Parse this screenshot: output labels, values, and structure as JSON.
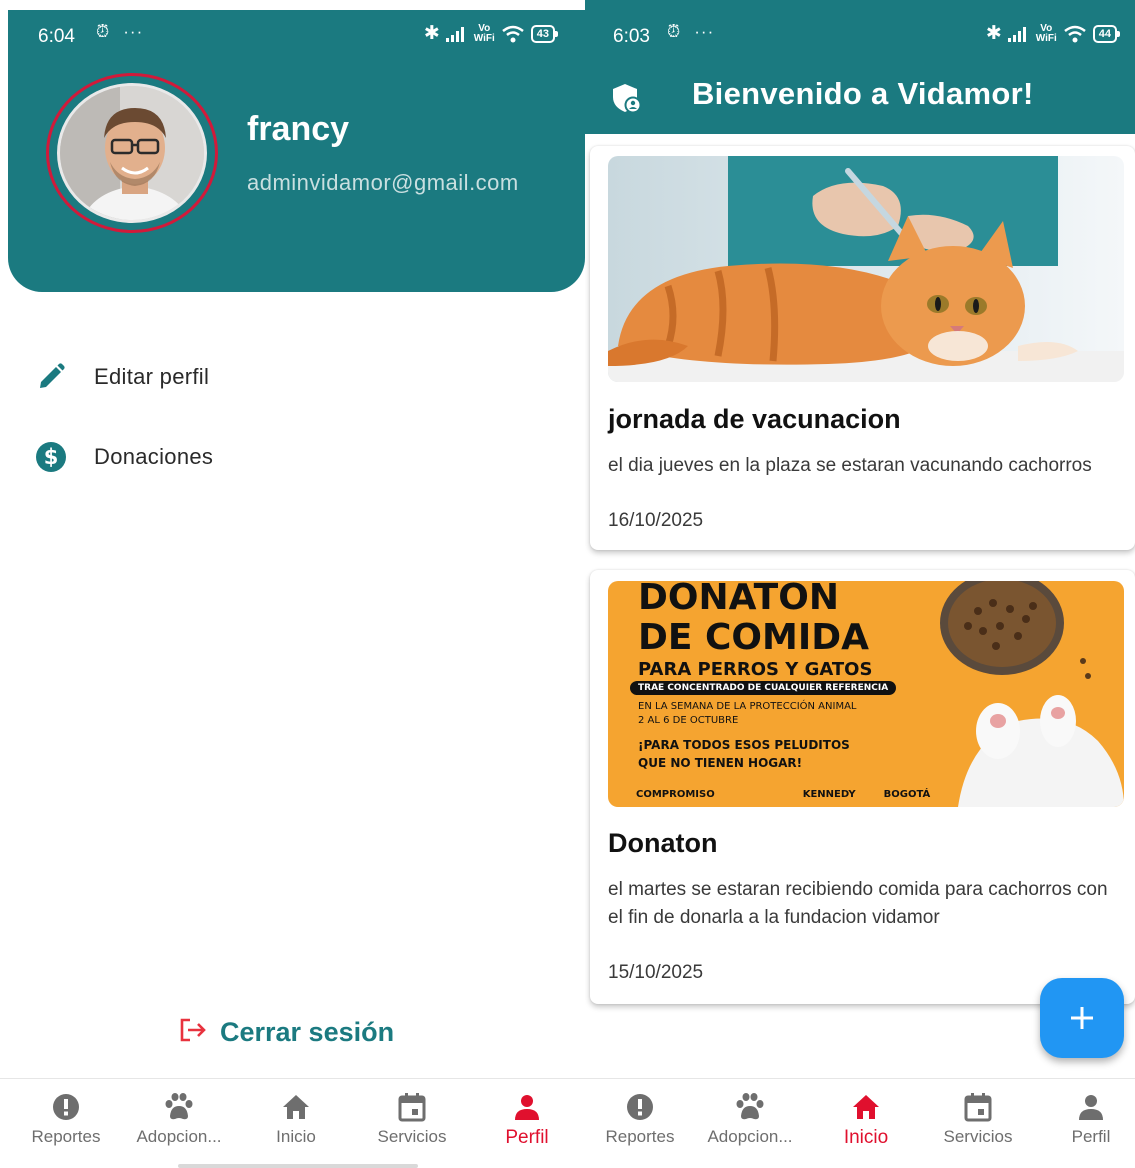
{
  "colors": {
    "teal": "#1b7a80",
    "accent_red": "#e0102e",
    "fab_blue": "#2196f3",
    "poster_orange": "#f5a430"
  },
  "profile_screen": {
    "status_bar": {
      "time": "6:04",
      "battery": "43",
      "wifi_label": "Vo WiFi"
    },
    "user": {
      "name": "francy",
      "email": "adminvidamor@gmail.com"
    },
    "menu": [
      {
        "label": "Editar perfil",
        "icon": "pencil-icon"
      },
      {
        "label": "Donaciones",
        "icon": "dollar-icon"
      }
    ],
    "logout_label": "Cerrar sesión",
    "nav": [
      {
        "label": "Reportes",
        "icon": "alert-icon",
        "active": false
      },
      {
        "label": "Adopcion...",
        "icon": "paw-icon",
        "active": false
      },
      {
        "label": "Inicio",
        "icon": "home-icon",
        "active": false
      },
      {
        "label": "Servicios",
        "icon": "calendar-icon",
        "active": false
      },
      {
        "label": "Perfil",
        "icon": "person-icon",
        "active": true
      }
    ]
  },
  "home_screen": {
    "status_bar": {
      "time": "6:03",
      "battery": "44",
      "wifi_label": "Vo WiFi"
    },
    "appbar_title": "Bienvenido a Vidamor!",
    "posts": [
      {
        "title": "jornada de vacunacion",
        "description": "el dia jueves en la plaza se estaran vacunando cachorros",
        "date": "16/10/2025",
        "image": "cat-vaccination-photo"
      },
      {
        "title": "Donaton",
        "description": "el martes se estaran recibiendo comida para cachorros con el fin de donarla a la fundacion vidamor",
        "date": "15/10/2025",
        "image": "donation-poster"
      }
    ],
    "poster": {
      "line1": "DONATON",
      "line2": "DE COMIDA",
      "line3": "PARA PERROS Y GATOS",
      "tag": "TRAE CONCENTRADO DE CUALQUIER REFERENCIA",
      "line4": "EN LA SEMANA DE LA PROTECCIÓN ANIMAL",
      "line5": "2 AL 6 DE OCTUBRE",
      "line6": "¡PARA TODOS ESOS PELUDITOS",
      "line7": "QUE NO TIENEN HOGAR!",
      "footer1": "COMPROMISO",
      "footer2": "KENNEDY",
      "footer3": "BOGOTÁ"
    },
    "fab_symbol": "+",
    "nav": [
      {
        "label": "Reportes",
        "icon": "alert-icon",
        "active": false
      },
      {
        "label": "Adopcion...",
        "icon": "paw-icon",
        "active": false
      },
      {
        "label": "Inicio",
        "icon": "home-icon",
        "active": true
      },
      {
        "label": "Servicios",
        "icon": "calendar-icon",
        "active": false
      },
      {
        "label": "Perfil",
        "icon": "person-icon",
        "active": false
      }
    ]
  }
}
